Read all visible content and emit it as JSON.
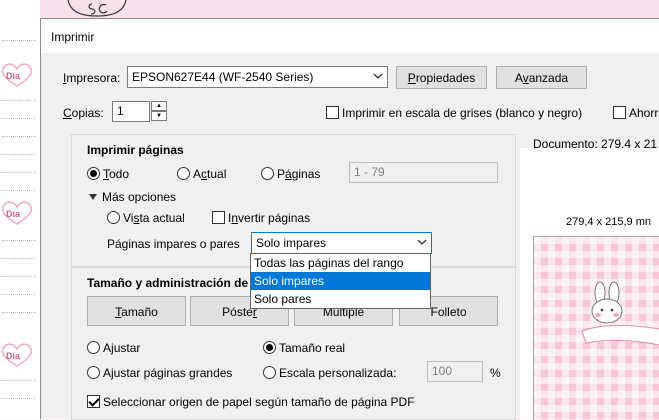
{
  "background": {
    "heart_labels": [
      "Día",
      "Día",
      "Día"
    ]
  },
  "dialog": {
    "title": "Imprimir",
    "printer_label": "Impresora:",
    "printer_value": "EPSON627E44 (WF-2540 Series)",
    "properties_button": "Propiedades",
    "advanced_button": "Avanzada",
    "copies_label": "Copias:",
    "copies_value": "1",
    "grayscale_label": "Imprimir en escala de grises (blanco y negro)",
    "grayscale_checked": false,
    "save_ink_label": "Ahorra",
    "print_pages": {
      "heading": "Imprimir páginas",
      "all_label": "Todo",
      "current_label": "Actual",
      "pages_label": "Páginas",
      "pages_value": "1 - 79",
      "selected": "all",
      "more_options_label": "Más opciones",
      "current_view_label": "Vista actual",
      "reverse_label": "Invertir páginas",
      "odd_even_label": "Páginas impares o pares",
      "odd_even_value": "Solo impares",
      "odd_even_options": [
        "Todas las páginas del rango",
        "Solo impares",
        "Solo pares"
      ],
      "odd_even_selected_index": 1
    },
    "size_handling": {
      "heading": "Tamaño y administración de p",
      "tabs": [
        "Tamaño",
        "Póster",
        "Múltiple",
        "Folleto"
      ],
      "fit_label": "Ajustar",
      "actual_size_label": "Tamaño real",
      "shrink_large_label": "Ajustar páginas grandes",
      "custom_scale_label": "Escala personalizada:",
      "custom_scale_value": "100",
      "percent": "%",
      "selected": "actual_size",
      "paper_source_label": "Seleccionar origen de papel según tamaño de página PDF",
      "paper_source_checked": true
    },
    "preview": {
      "document_label": "Documento: 279,4 x 21",
      "page_size_label": "279,4 x 215,9 mn"
    }
  },
  "colors": {
    "accent": "#0078d7",
    "preview_pink": "#f7c7d8"
  }
}
